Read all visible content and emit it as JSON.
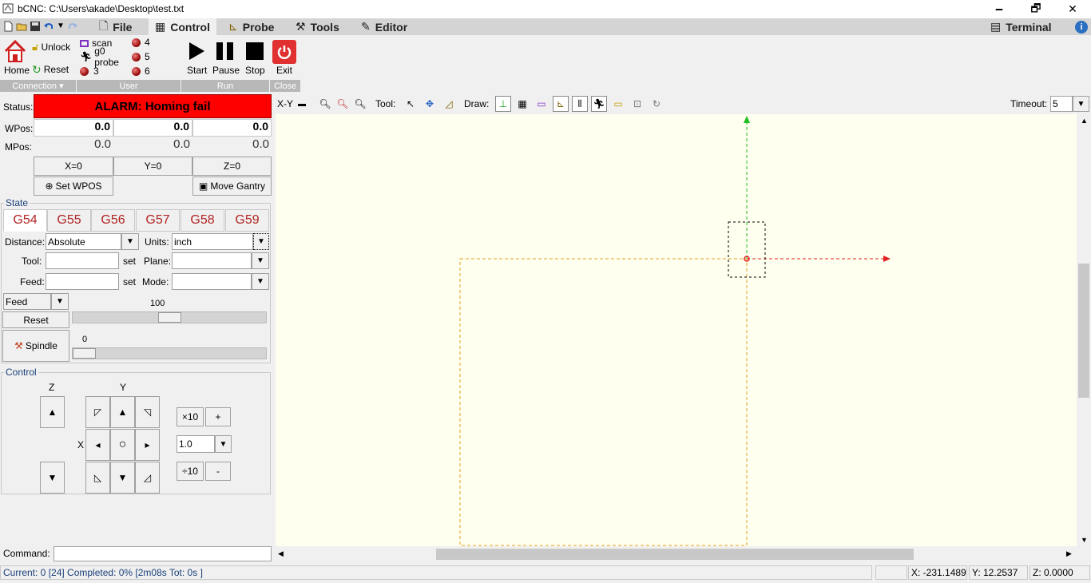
{
  "window": {
    "title": "bCNC: C:\\Users\\akade\\Desktop\\test.txt",
    "minimize": "🗕",
    "restore": "🗗",
    "close": "✕"
  },
  "tabs": [
    {
      "label": "File",
      "icon": "file-icon"
    },
    {
      "label": "Control",
      "icon": "control-icon"
    },
    {
      "label": "Probe",
      "icon": "probe-icon"
    },
    {
      "label": "Tools",
      "icon": "tools-icon"
    },
    {
      "label": "Editor",
      "icon": "editor-icon"
    },
    {
      "label": "Terminal",
      "icon": "terminal-icon"
    }
  ],
  "ribbon": {
    "connection": {
      "home": "Home",
      "unlock": "Unlock",
      "reset": "Reset",
      "group": "Connection"
    },
    "user": {
      "scan": "scan",
      "g0probe": "g0 probe",
      "b3": "3",
      "b4": "4",
      "b5": "5",
      "b6": "6",
      "group": "User"
    },
    "run": {
      "start": "Start",
      "pause": "Pause",
      "stop": "Stop",
      "group": "Run"
    },
    "close": {
      "exit": "Exit",
      "group": "Close"
    }
  },
  "status": {
    "label": "Status:",
    "value": "ALARM: Homing fail",
    "color": "#ff0000"
  },
  "dro": {
    "wpos_label": "WPos:",
    "mpos_label": "MPos:",
    "wpos": [
      "0.0",
      "0.0",
      "0.0"
    ],
    "mpos": [
      "0.0",
      "0.0",
      "0.0"
    ],
    "zero": [
      "X=0",
      "Y=0",
      "Z=0"
    ],
    "set_wpos": "Set WPOS",
    "move_gantry": "Move Gantry"
  },
  "state": {
    "title": "State",
    "gcodes": [
      "G54",
      "G55",
      "G56",
      "G57",
      "G58",
      "G59"
    ],
    "distance_label": "Distance:",
    "distance": "Absolute",
    "units_label": "Units:",
    "units": "inch",
    "tool_label": "Tool:",
    "tool": "",
    "plane_label": "Plane:",
    "plane": "",
    "feed_label": "Feed:",
    "feed": "",
    "mode_label": "Mode:",
    "mode": "",
    "set": "set",
    "override": "Feed",
    "override_value": "100",
    "override_level": 100,
    "reset": "Reset",
    "spindle": "Spindle",
    "spindle_value": "0",
    "spindle_level": 0
  },
  "control": {
    "title": "Control",
    "z": "Z",
    "y": "Y",
    "x": "X",
    "up": "▲",
    "down": "▼",
    "left": "◂",
    "right": "▸",
    "center": "○",
    "ul": "◸",
    "ur": "◹",
    "ll": "◺",
    "lr": "◿",
    "x10": "×10",
    "plus": "+",
    "d10": "÷10",
    "minus": "-",
    "step": "1.0"
  },
  "canvas_toolbar": {
    "view": "X-Y",
    "tool_label": "Tool:",
    "draw_label": "Draw:",
    "timeout_label": "Timeout:",
    "timeout": "5"
  },
  "command": {
    "label": "Command:",
    "value": ""
  },
  "statusbar": {
    "progress": "Current: 0 [24]  Completed: 0% [2m08s Tot: 0s ]",
    "x": "X: -231.1489",
    "y": "Y: 12.2537",
    "z": "Z: 0.0000"
  }
}
